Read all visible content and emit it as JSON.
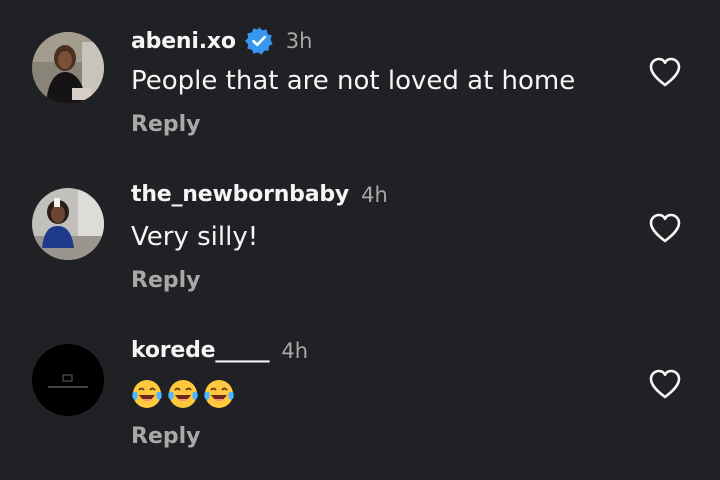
{
  "comments": [
    {
      "username": "abeni.xo",
      "verified": true,
      "time": "3h",
      "text": "People that are not loved at home",
      "reply_label": "Reply"
    },
    {
      "username": "the_newbornbaby",
      "verified": false,
      "time": "4h",
      "text": "Very silly!",
      "reply_label": "Reply"
    },
    {
      "username": "korede_____",
      "verified": false,
      "time": "4h",
      "text": "😂😂😂",
      "reply_label": "Reply"
    }
  ],
  "icons": {
    "like": "heart-outline-icon",
    "verified": "verified-badge-icon",
    "emoji": "face-with-tears-of-joy-icon"
  },
  "colors": {
    "background": "#202124",
    "primary_text": "#f5f5f5",
    "secondary_text": "#a8a8a8",
    "verified_blue": "#3797f0"
  }
}
